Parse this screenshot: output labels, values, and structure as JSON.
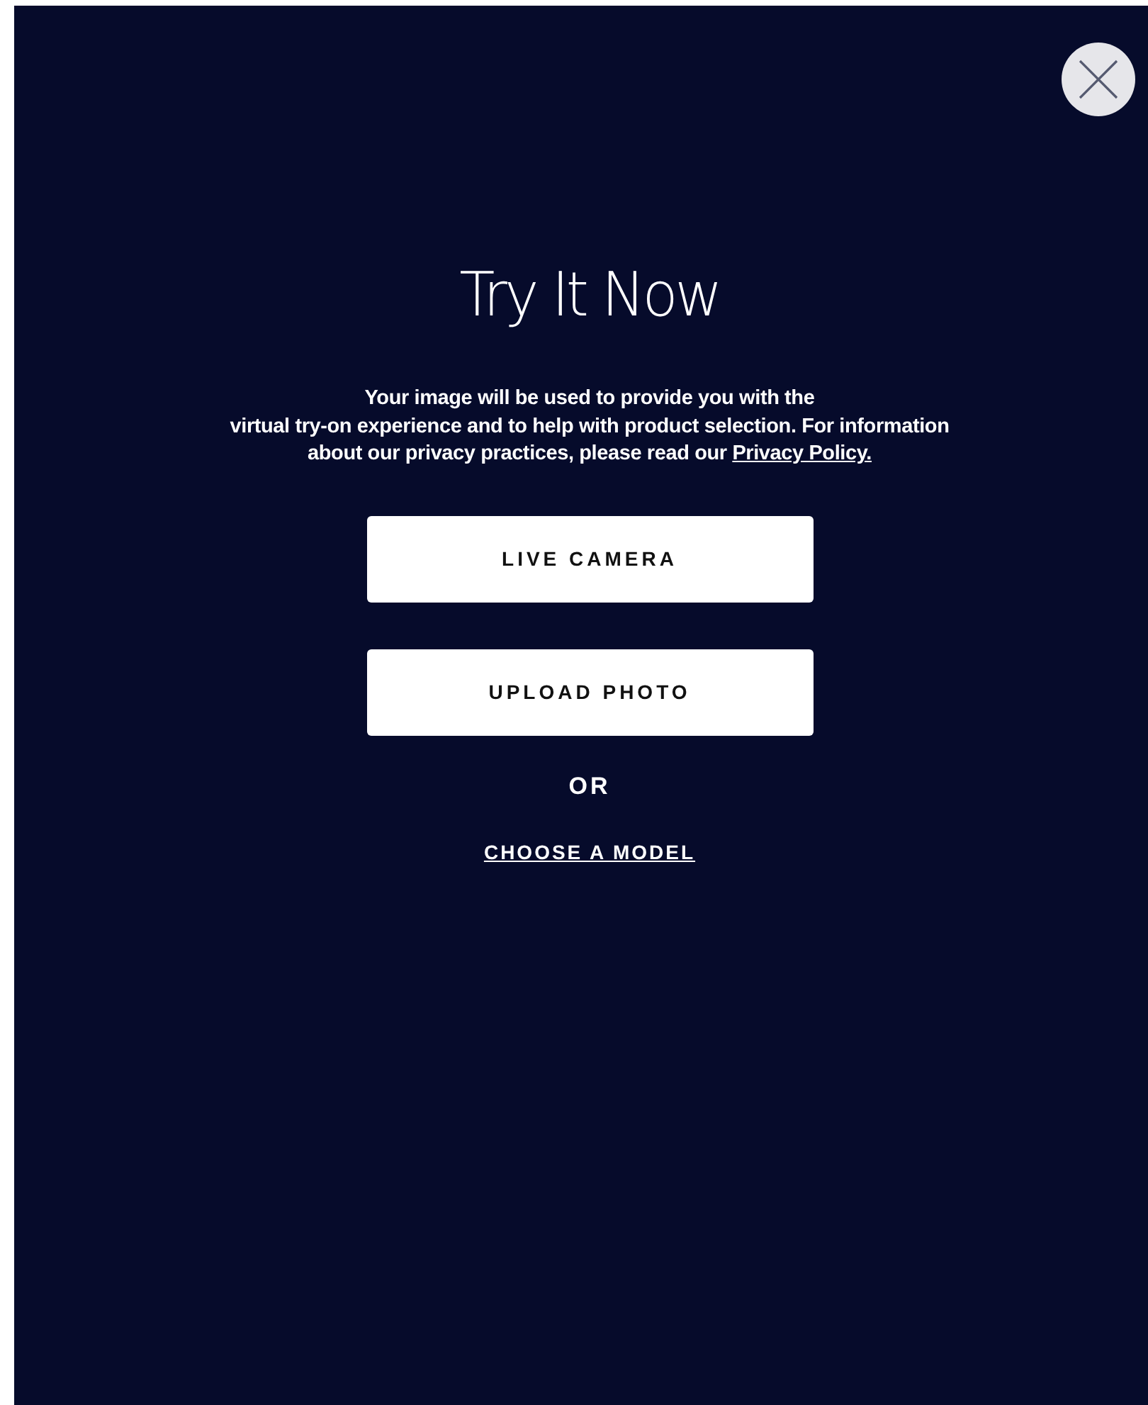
{
  "dialog": {
    "title": "Try It Now",
    "notice": {
      "lines": [
        "Your image will be used to provide you with the",
        "virtual try-on experience and to help with product selection. For information",
        "about our privacy practices, please read our"
      ],
      "link": "Privacy Policy."
    },
    "buttons": [
      {
        "label": "LIVE CAMERA"
      },
      {
        "label": "UPLOAD PHOTO"
      }
    ],
    "separator": "OR",
    "model_link": "CHOOSE A MODEL"
  }
}
